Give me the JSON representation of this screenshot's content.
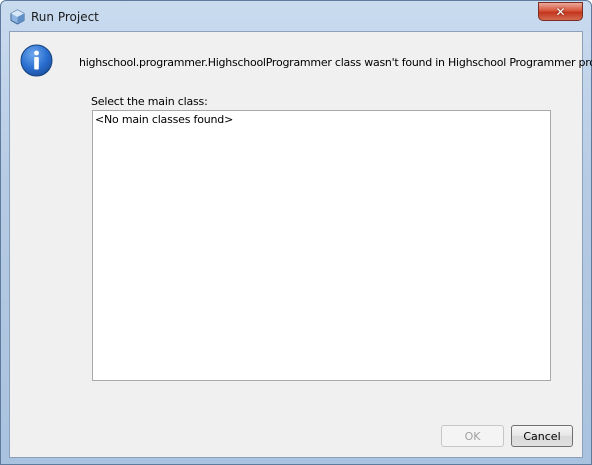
{
  "window": {
    "title": "Run Project",
    "close_glyph": "✕"
  },
  "dialog": {
    "icon": "info-icon",
    "message": "highschool.programmer.HighschoolProgrammer class wasn't found in Highschool Programmer project.",
    "select_label": "Select the main class:",
    "list_items": [
      "<No main classes found>"
    ]
  },
  "buttons": {
    "ok_label": "OK",
    "ok_enabled": false,
    "cancel_label": "Cancel"
  },
  "colors": {
    "info_blue": "#2a6fd0",
    "close_red": "#c4351e"
  }
}
